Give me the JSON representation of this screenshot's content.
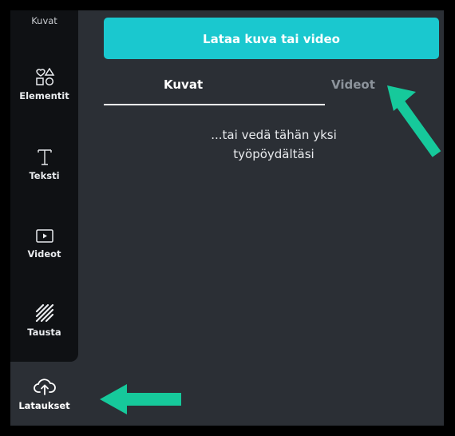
{
  "sidebar": {
    "items": [
      {
        "label": "Kuvat",
        "icon": "photo-icon"
      },
      {
        "label": "Elementit",
        "icon": "shapes-icon"
      },
      {
        "label": "Teksti",
        "icon": "text-t-icon"
      },
      {
        "label": "Videot",
        "icon": "video-play-icon"
      },
      {
        "label": "Tausta",
        "icon": "hatch-pattern-icon"
      }
    ],
    "uploads": {
      "label": "Lataukset",
      "icon": "cloud-upload-icon"
    }
  },
  "main": {
    "upload_button": "Lataa kuva tai video",
    "tabs": [
      {
        "label": "Kuvat",
        "active": true
      },
      {
        "label": "Videot",
        "active": false
      }
    ],
    "drop_hint_line1": "...tai vedä tähän yksi",
    "drop_hint_line2": "työpöydältäsi"
  },
  "colors": {
    "accent": "#1ac8cf",
    "panel_bg": "#2b2f35",
    "sidebar_bg": "#0f1114",
    "annotation_arrow": "#16c99b"
  }
}
